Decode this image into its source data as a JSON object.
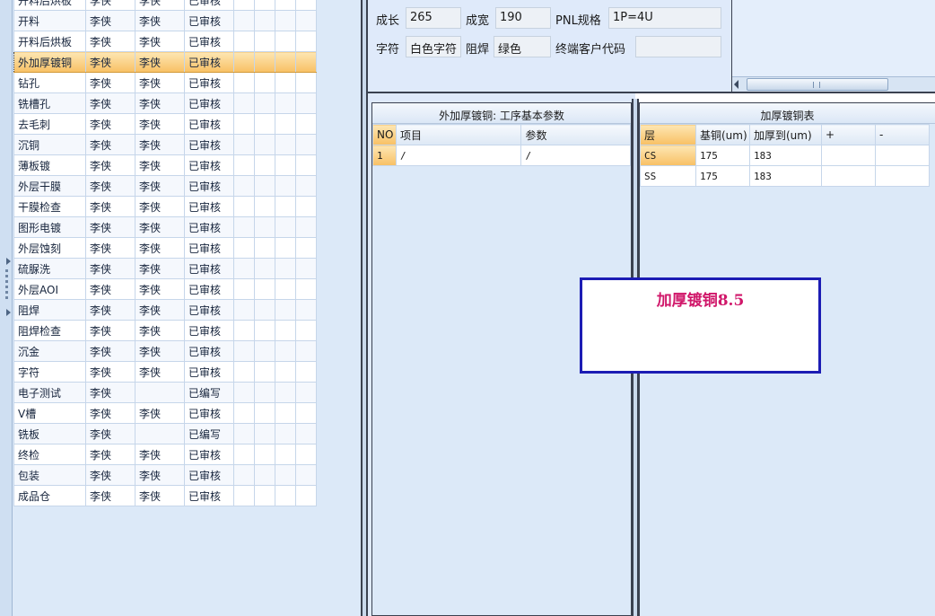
{
  "process_grid": {
    "rows": [
      {
        "name": "开料后烘板",
        "c1": "李侠",
        "c2": "李侠",
        "status": "已审核"
      },
      {
        "name": "开料",
        "c1": "李侠",
        "c2": "李侠",
        "status": "已审核"
      },
      {
        "name": "开料后烘板",
        "c1": "李侠",
        "c2": "李侠",
        "status": "已审核"
      },
      {
        "name": "外加厚镀铜",
        "c1": "李侠",
        "c2": "李侠",
        "status": "已审核",
        "selected": true
      },
      {
        "name": "钻孔",
        "c1": "李侠",
        "c2": "李侠",
        "status": "已审核"
      },
      {
        "name": "铣槽孔",
        "c1": "李侠",
        "c2": "李侠",
        "status": "已审核"
      },
      {
        "name": "去毛刺",
        "c1": "李侠",
        "c2": "李侠",
        "status": "已审核"
      },
      {
        "name": "沉铜",
        "c1": "李侠",
        "c2": "李侠",
        "status": "已审核"
      },
      {
        "name": "薄板镀",
        "c1": "李侠",
        "c2": "李侠",
        "status": "已审核"
      },
      {
        "name": "外层干膜",
        "c1": "李侠",
        "c2": "李侠",
        "status": "已审核"
      },
      {
        "name": "干膜检查",
        "c1": "李侠",
        "c2": "李侠",
        "status": "已审核"
      },
      {
        "name": "图形电镀",
        "c1": "李侠",
        "c2": "李侠",
        "status": "已审核"
      },
      {
        "name": "外层蚀刻",
        "c1": "李侠",
        "c2": "李侠",
        "status": "已审核"
      },
      {
        "name": "硫脲洗",
        "c1": "李侠",
        "c2": "李侠",
        "status": "已审核"
      },
      {
        "name": "外层AOI",
        "c1": "李侠",
        "c2": "李侠",
        "status": "已审核"
      },
      {
        "name": "阻焊",
        "c1": "李侠",
        "c2": "李侠",
        "status": "已审核"
      },
      {
        "name": "阻焊检查",
        "c1": "李侠",
        "c2": "李侠",
        "status": "已审核"
      },
      {
        "name": "沉金",
        "c1": "李侠",
        "c2": "李侠",
        "status": "已审核"
      },
      {
        "name": "字符",
        "c1": "李侠",
        "c2": "李侠",
        "status": "已审核"
      },
      {
        "name": "电子测试",
        "c1": "李侠",
        "c2": "",
        "status": "已编写"
      },
      {
        "name": "V槽",
        "c1": "李侠",
        "c2": "李侠",
        "status": "已审核"
      },
      {
        "name": "铣板",
        "c1": "李侠",
        "c2": "",
        "status": "已编写"
      },
      {
        "name": "终检",
        "c1": "李侠",
        "c2": "李侠",
        "status": "已审核"
      },
      {
        "name": "包装",
        "c1": "李侠",
        "c2": "李侠",
        "status": "已审核"
      },
      {
        "name": "成品仓",
        "c1": "李侠",
        "c2": "李侠",
        "status": "已审核"
      }
    ]
  },
  "board_form": {
    "length_label": "成长",
    "length_value": "265",
    "width_label": "成宽",
    "width_value": "190",
    "pnl_label": "PNL规格",
    "pnl_value": "1P=4U",
    "legend_label": "字符",
    "legend_value": "白色字符",
    "mask_label": "阻焊",
    "mask_value": "绿色",
    "customer_code_label": "终端客户代码",
    "customer_code_value": ""
  },
  "params_panel": {
    "title": "外加厚镀铜: 工序基本参数",
    "headers": [
      "NO",
      "项目",
      "参数"
    ],
    "rows": [
      [
        "1",
        "/",
        "/"
      ]
    ]
  },
  "thickness_panel": {
    "title": "加厚镀铜表",
    "headers": [
      "层",
      "基铜(um)",
      "加厚到(um)",
      "+",
      "-"
    ],
    "rows": [
      [
        "CS",
        "175",
        "183",
        "",
        ""
      ],
      [
        "SS",
        "175",
        "183",
        "",
        ""
      ]
    ]
  },
  "popup": {
    "text": "加厚镀铜8.5",
    "text_color": "#d0176a",
    "border_color": "#1c1cb4"
  },
  "colors": {
    "selection": "#f8c064",
    "panel_bg": "#dce9f8"
  }
}
